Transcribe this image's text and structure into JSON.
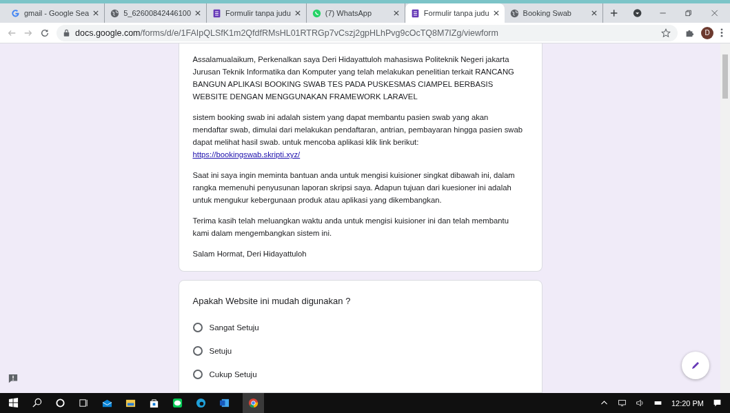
{
  "browser": {
    "tabs": [
      {
        "title": "gmail - Google Sea",
        "kind": "google",
        "selected": false
      },
      {
        "title": "5_62600842446100",
        "kind": "globe",
        "selected": false
      },
      {
        "title": "Formulir tanpa judu",
        "kind": "forms",
        "selected": false
      },
      {
        "title": "(7) WhatsApp",
        "kind": "whatsapp",
        "selected": false
      },
      {
        "title": "Formulir tanpa judu",
        "kind": "forms",
        "selected": true
      },
      {
        "title": "Booking Swab",
        "kind": "globe",
        "selected": false
      }
    ],
    "url_host": "docs.google.com",
    "url_path": "/forms/d/e/1FAIpQLSfK1m2QfdfRMsHL01RTRGp7vCszj2gpHLhPvg9cOcTQ8M7IZg/viewform",
    "profile_initial": "D"
  },
  "description": {
    "paragraphs": [
      {
        "kind": "text",
        "text": "Assalamualaikum, Perkenalkan saya Deri Hidayattuloh mahasiswa Politeknik Negeri jakarta Jurusan Teknik Informatika dan Komputer yang telah melakukan penelitian terkait RANCANG BANGUN APLIKASI BOOKING SWAB TES PADA PUSKESMAS CIAMPEL BERBASIS WEBSITE DENGAN MENGGUNAKAN FRAMEWORK LARAVEL"
      },
      {
        "kind": "text",
        "text": "sistem booking swab ini adalah sistem yang dapat membantu pasien swab yang akan mendaftar swab, dimulai dari melakukan pendaftaran, antrian, pembayaran hingga pasien swab dapat melihat hasil swab. untuk mencoba aplikasi klik link berikut:",
        "link": "https://bookingswab.skripti.xyz/"
      },
      {
        "kind": "text",
        "text": "Saat ini saya ingin meminta bantuan anda untuk mengisi kuisioner singkat dibawah ini, dalam rangka memenuhi penyusunan laporan skripsi saya. Adapun tujuan dari kuesioner ini adalah untuk mengukur kebergunaan produk atau aplikasi yang dikembangkan."
      },
      {
        "kind": "text",
        "text": "Terima kasih telah meluangkan waktu anda untuk mengisi kuisioner ini dan telah membantu kami dalam mengembangkan sistem ini."
      },
      {
        "kind": "text",
        "text": "Salam Hormat, Deri Hidayattuloh"
      }
    ]
  },
  "question": {
    "title": "Apakah Website ini mudah digunakan ?",
    "options": [
      {
        "label": "Sangat Setuju",
        "selected": false
      },
      {
        "label": "Setuju",
        "selected": false
      },
      {
        "label": "Cukup Setuju",
        "selected": false
      }
    ]
  },
  "taskbar": {
    "time": "12:20 PM"
  }
}
